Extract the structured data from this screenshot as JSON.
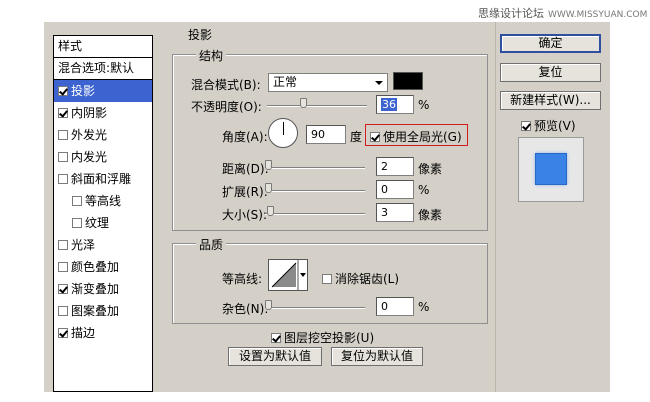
{
  "watermark": {
    "text": "思缘设计论坛",
    "url": "WWW.MISSYUAN.COM"
  },
  "styles_panel": {
    "header": "样式",
    "blending": "混合选项:默认",
    "items": [
      {
        "label": "投影",
        "checked": true,
        "selected": true
      },
      {
        "label": "内阴影",
        "checked": true
      },
      {
        "label": "外发光",
        "checked": false
      },
      {
        "label": "内发光",
        "checked": false
      },
      {
        "label": "斜面和浮雕",
        "checked": false
      },
      {
        "label": "等高线",
        "checked": false
      },
      {
        "label": "纹理",
        "checked": false
      },
      {
        "label": "光泽",
        "checked": false
      },
      {
        "label": "颜色叠加",
        "checked": false
      },
      {
        "label": "渐变叠加",
        "checked": true
      },
      {
        "label": "图案叠加",
        "checked": false
      },
      {
        "label": "描边",
        "checked": true
      }
    ]
  },
  "section_title": "投影",
  "structure": {
    "title": "结构",
    "blend_mode_label": "混合模式(B):",
    "blend_mode_value": "正常",
    "blend_color": "#000000",
    "opacity_label": "不透明度(O):",
    "opacity_value": "36",
    "opacity_unit": "%",
    "opacity_slider": 0.36,
    "angle_label": "角度(A):",
    "angle_value": "90",
    "angle_unit": "度",
    "global_light_label": "使用全局光(G)",
    "global_light_checked": true,
    "distance_label": "距离(D):",
    "distance_value": "2",
    "distance_unit": "像素",
    "spread_label": "扩展(R):",
    "spread_value": "0",
    "spread_unit": "%",
    "size_label": "大小(S):",
    "size_value": "3",
    "size_unit": "像素"
  },
  "quality": {
    "title": "品质",
    "contour_label": "等高线:",
    "anti_alias_label": "消除锯齿(L)",
    "anti_alias_checked": false,
    "noise_label": "杂色(N):",
    "noise_value": "0",
    "noise_unit": "%"
  },
  "knockout_label": "图层挖空投影(U)",
  "knockout_checked": true,
  "make_default_label": "设置为默认值",
  "reset_default_label": "复位为默认值",
  "buttons": {
    "ok": "确定",
    "reset": "复位",
    "new_style": "新建样式(W)..."
  },
  "preview_label": "预览(V)",
  "preview_checked": true,
  "colors": {
    "selection": "#3c63cf",
    "preview_square": "#3b82e6",
    "highlight_box": "#d21d1d"
  }
}
